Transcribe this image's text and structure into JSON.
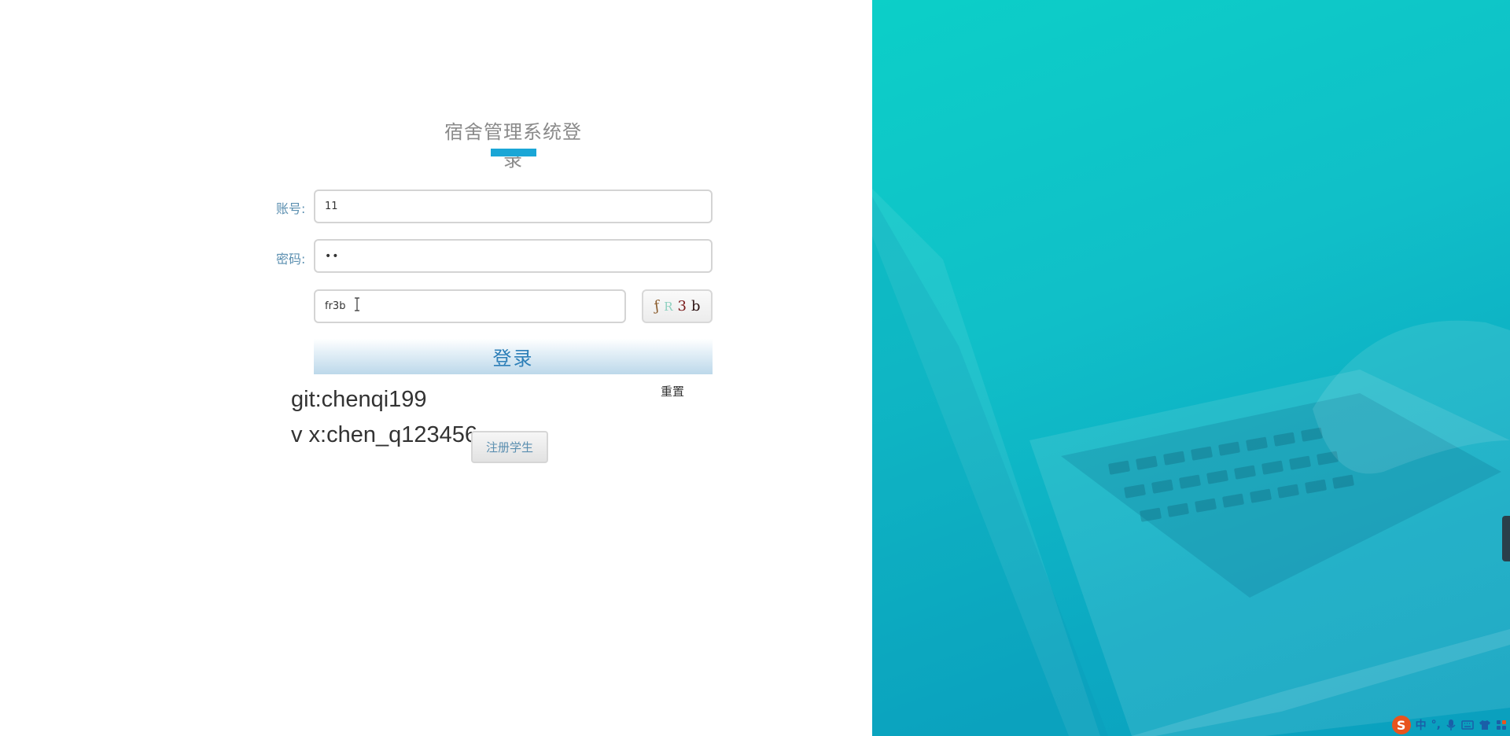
{
  "login": {
    "title": "宿舍管理系统登录",
    "account_label": "账号:",
    "account_value": "11",
    "password_label": "密码:",
    "password_value": "••",
    "captcha_value": "fr3b",
    "captcha_chars": [
      "ƒ",
      "R",
      "3",
      "b"
    ],
    "login_button": "登录",
    "reset_link": "重置",
    "register_button": "注册学生",
    "accent_color": "#1aa6d6"
  },
  "info": {
    "git": "git:chenqi199",
    "vx": "v x:chen_q123456"
  },
  "ime_tray": {
    "logo": "S",
    "mode": "中",
    "punct": "°,",
    "icons": [
      "microphone-icon",
      "keyboard-icon",
      "shirt-icon",
      "grid-icon"
    ]
  }
}
